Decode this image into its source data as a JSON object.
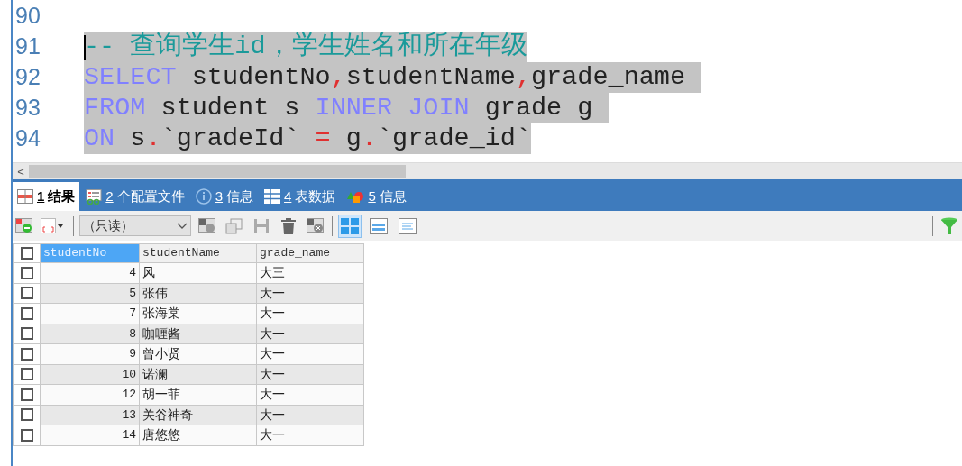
{
  "editor": {
    "lines": [
      {
        "number": "90"
      },
      {
        "number": "91",
        "selected": true,
        "cursor": true,
        "tokens": [
          {
            "text": "-- 查询学生id，学生姓名和所在年级",
            "kind": "comment"
          }
        ]
      },
      {
        "number": "92",
        "selected": true,
        "tokens": [
          {
            "text": "SELECT",
            "kind": "keyword"
          },
          {
            "text": " studentNo",
            "kind": "plain"
          },
          {
            "text": ",",
            "kind": "operator"
          },
          {
            "text": "studentName",
            "kind": "plain"
          },
          {
            "text": ",",
            "kind": "operator"
          },
          {
            "text": "grade_name ",
            "kind": "plain"
          }
        ]
      },
      {
        "number": "93",
        "selected": true,
        "tokens": [
          {
            "text": "FROM",
            "kind": "keyword"
          },
          {
            "text": " student s ",
            "kind": "plain"
          },
          {
            "text": "INNER JOIN",
            "kind": "keyword"
          },
          {
            "text": " grade g ",
            "kind": "plain"
          }
        ]
      },
      {
        "number": "94",
        "selected": true,
        "tokens": [
          {
            "text": "ON",
            "kind": "keyword"
          },
          {
            "text": " s",
            "kind": "plain"
          },
          {
            "text": ".",
            "kind": "operator"
          },
          {
            "text": "`gradeId` ",
            "kind": "plain"
          },
          {
            "text": "=",
            "kind": "operator"
          },
          {
            "text": " g",
            "kind": "plain"
          },
          {
            "text": ".",
            "kind": "operator"
          },
          {
            "text": "`grade_id`",
            "kind": "plain"
          }
        ]
      }
    ],
    "scroll_arrow": "<"
  },
  "tabs": [
    {
      "number": "1",
      "label": "结果",
      "selected": true,
      "kind": "grid"
    },
    {
      "number": "2",
      "label": "个配置文件",
      "selected": false,
      "kind": "profile"
    },
    {
      "number": "3",
      "label": "信息",
      "selected": false,
      "kind": "info"
    },
    {
      "number": "4",
      "label": "表数据",
      "selected": false,
      "kind": "table"
    },
    {
      "number": "5",
      "label": "信息",
      "selected": false,
      "kind": "shapes"
    }
  ],
  "toolbar": {
    "mode_select": "（只读）",
    "views": [
      {
        "selected": true
      },
      {
        "selected": false
      },
      {
        "selected": false
      }
    ]
  },
  "grid": {
    "select_all": {
      "checked": false
    },
    "columns": [
      {
        "label": "studentNo",
        "selected": true
      },
      {
        "label": "studentName",
        "selected": false
      },
      {
        "label": "grade_name",
        "selected": false
      }
    ],
    "rows": [
      {
        "checked": false,
        "cells": [
          "4",
          "风",
          "大三"
        ]
      },
      {
        "checked": false,
        "cells": [
          "5",
          "张伟",
          "大一"
        ]
      },
      {
        "checked": false,
        "cells": [
          "7",
          "张海棠",
          "大一"
        ]
      },
      {
        "checked": false,
        "cells": [
          "8",
          "咖喱酱",
          "大一"
        ]
      },
      {
        "checked": false,
        "cells": [
          "9",
          "曾小贤",
          "大一"
        ]
      },
      {
        "checked": false,
        "cells": [
          "10",
          "诺澜",
          "大一"
        ]
      },
      {
        "checked": false,
        "cells": [
          "12",
          "胡一菲",
          "大一"
        ]
      },
      {
        "checked": false,
        "cells": [
          "13",
          "关谷神奇",
          "大一"
        ]
      },
      {
        "checked": false,
        "cells": [
          "14",
          "唐悠悠",
          "大一"
        ]
      }
    ]
  }
}
